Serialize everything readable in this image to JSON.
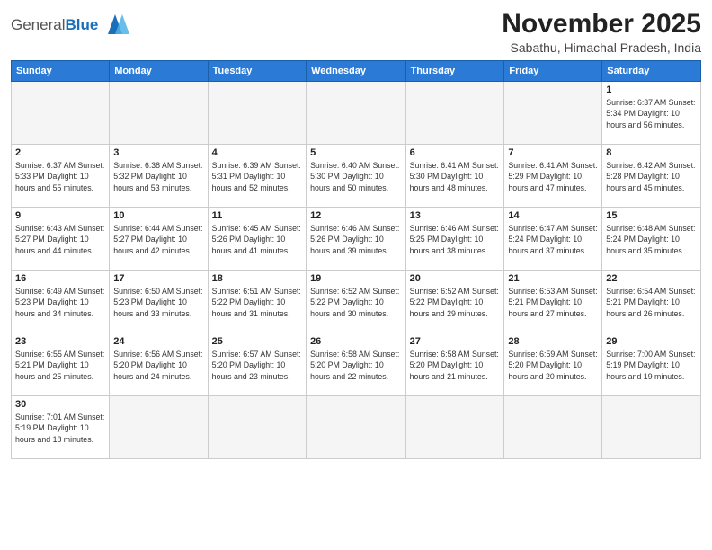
{
  "header": {
    "title": "November 2025",
    "location": "Sabathu, Himachal Pradesh, India",
    "logo_general": "General",
    "logo_blue": "Blue"
  },
  "weekdays": [
    "Sunday",
    "Monday",
    "Tuesday",
    "Wednesday",
    "Thursday",
    "Friday",
    "Saturday"
  ],
  "weeks": [
    [
      {
        "day": "",
        "info": ""
      },
      {
        "day": "",
        "info": ""
      },
      {
        "day": "",
        "info": ""
      },
      {
        "day": "",
        "info": ""
      },
      {
        "day": "",
        "info": ""
      },
      {
        "day": "",
        "info": ""
      },
      {
        "day": "1",
        "info": "Sunrise: 6:37 AM\nSunset: 5:34 PM\nDaylight: 10 hours\nand 56 minutes."
      }
    ],
    [
      {
        "day": "2",
        "info": "Sunrise: 6:37 AM\nSunset: 5:33 PM\nDaylight: 10 hours\nand 55 minutes."
      },
      {
        "day": "3",
        "info": "Sunrise: 6:38 AM\nSunset: 5:32 PM\nDaylight: 10 hours\nand 53 minutes."
      },
      {
        "day": "4",
        "info": "Sunrise: 6:39 AM\nSunset: 5:31 PM\nDaylight: 10 hours\nand 52 minutes."
      },
      {
        "day": "5",
        "info": "Sunrise: 6:40 AM\nSunset: 5:30 PM\nDaylight: 10 hours\nand 50 minutes."
      },
      {
        "day": "6",
        "info": "Sunrise: 6:41 AM\nSunset: 5:30 PM\nDaylight: 10 hours\nand 48 minutes."
      },
      {
        "day": "7",
        "info": "Sunrise: 6:41 AM\nSunset: 5:29 PM\nDaylight: 10 hours\nand 47 minutes."
      },
      {
        "day": "8",
        "info": "Sunrise: 6:42 AM\nSunset: 5:28 PM\nDaylight: 10 hours\nand 45 minutes."
      }
    ],
    [
      {
        "day": "9",
        "info": "Sunrise: 6:43 AM\nSunset: 5:27 PM\nDaylight: 10 hours\nand 44 minutes."
      },
      {
        "day": "10",
        "info": "Sunrise: 6:44 AM\nSunset: 5:27 PM\nDaylight: 10 hours\nand 42 minutes."
      },
      {
        "day": "11",
        "info": "Sunrise: 6:45 AM\nSunset: 5:26 PM\nDaylight: 10 hours\nand 41 minutes."
      },
      {
        "day": "12",
        "info": "Sunrise: 6:46 AM\nSunset: 5:26 PM\nDaylight: 10 hours\nand 39 minutes."
      },
      {
        "day": "13",
        "info": "Sunrise: 6:46 AM\nSunset: 5:25 PM\nDaylight: 10 hours\nand 38 minutes."
      },
      {
        "day": "14",
        "info": "Sunrise: 6:47 AM\nSunset: 5:24 PM\nDaylight: 10 hours\nand 37 minutes."
      },
      {
        "day": "15",
        "info": "Sunrise: 6:48 AM\nSunset: 5:24 PM\nDaylight: 10 hours\nand 35 minutes."
      }
    ],
    [
      {
        "day": "16",
        "info": "Sunrise: 6:49 AM\nSunset: 5:23 PM\nDaylight: 10 hours\nand 34 minutes."
      },
      {
        "day": "17",
        "info": "Sunrise: 6:50 AM\nSunset: 5:23 PM\nDaylight: 10 hours\nand 33 minutes."
      },
      {
        "day": "18",
        "info": "Sunrise: 6:51 AM\nSunset: 5:22 PM\nDaylight: 10 hours\nand 31 minutes."
      },
      {
        "day": "19",
        "info": "Sunrise: 6:52 AM\nSunset: 5:22 PM\nDaylight: 10 hours\nand 30 minutes."
      },
      {
        "day": "20",
        "info": "Sunrise: 6:52 AM\nSunset: 5:22 PM\nDaylight: 10 hours\nand 29 minutes."
      },
      {
        "day": "21",
        "info": "Sunrise: 6:53 AM\nSunset: 5:21 PM\nDaylight: 10 hours\nand 27 minutes."
      },
      {
        "day": "22",
        "info": "Sunrise: 6:54 AM\nSunset: 5:21 PM\nDaylight: 10 hours\nand 26 minutes."
      }
    ],
    [
      {
        "day": "23",
        "info": "Sunrise: 6:55 AM\nSunset: 5:21 PM\nDaylight: 10 hours\nand 25 minutes."
      },
      {
        "day": "24",
        "info": "Sunrise: 6:56 AM\nSunset: 5:20 PM\nDaylight: 10 hours\nand 24 minutes."
      },
      {
        "day": "25",
        "info": "Sunrise: 6:57 AM\nSunset: 5:20 PM\nDaylight: 10 hours\nand 23 minutes."
      },
      {
        "day": "26",
        "info": "Sunrise: 6:58 AM\nSunset: 5:20 PM\nDaylight: 10 hours\nand 22 minutes."
      },
      {
        "day": "27",
        "info": "Sunrise: 6:58 AM\nSunset: 5:20 PM\nDaylight: 10 hours\nand 21 minutes."
      },
      {
        "day": "28",
        "info": "Sunrise: 6:59 AM\nSunset: 5:20 PM\nDaylight: 10 hours\nand 20 minutes."
      },
      {
        "day": "29",
        "info": "Sunrise: 7:00 AM\nSunset: 5:19 PM\nDaylight: 10 hours\nand 19 minutes."
      }
    ],
    [
      {
        "day": "30",
        "info": "Sunrise: 7:01 AM\nSunset: 5:19 PM\nDaylight: 10 hours\nand 18 minutes."
      },
      {
        "day": "",
        "info": ""
      },
      {
        "day": "",
        "info": ""
      },
      {
        "day": "",
        "info": ""
      },
      {
        "day": "",
        "info": ""
      },
      {
        "day": "",
        "info": ""
      },
      {
        "day": "",
        "info": ""
      }
    ]
  ]
}
